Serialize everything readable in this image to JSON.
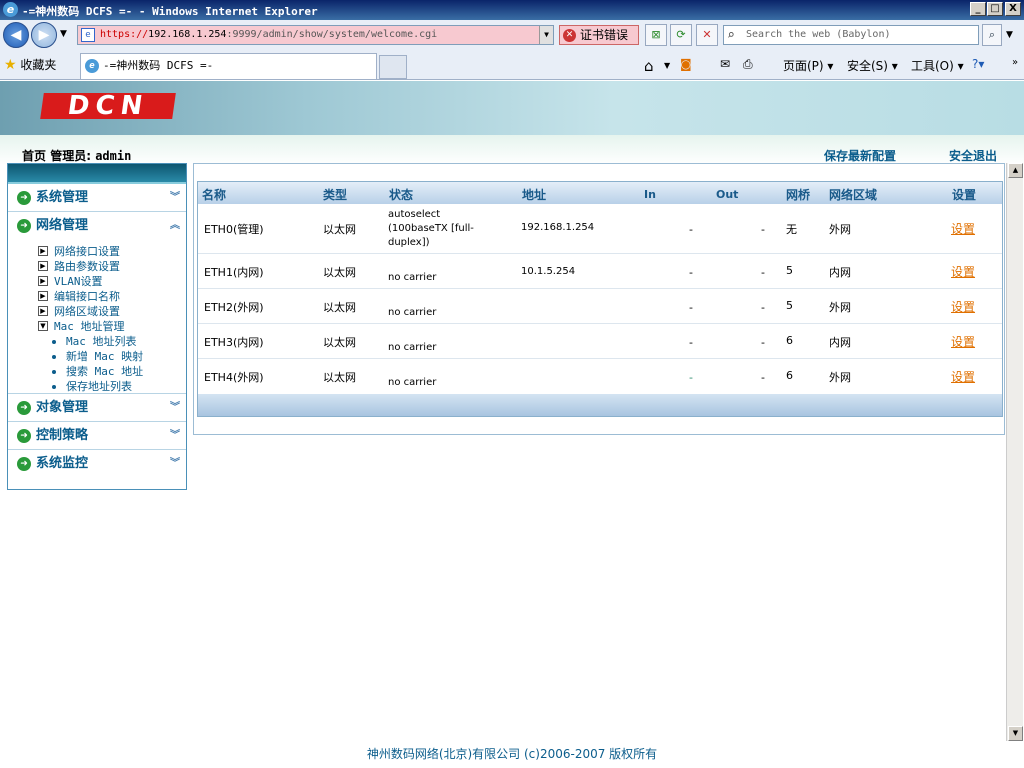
{
  "window": {
    "title": "-=神州数码 DCFS =- - Windows Internet Explorer",
    "minimize": "_",
    "maximize": "□",
    "close": "X"
  },
  "address": {
    "scheme": "https://",
    "host": "192.168.1.254",
    "rest": ":9999/admin/show/system/welcome.cgi",
    "cert_error": "证书错误",
    "search_placeholder": "Search the web (Babylon)"
  },
  "favbar": {
    "favorites": "收藏夹",
    "tab_title": "-=神州数码 DCFS =-",
    "page_menu": "页面(P)",
    "safety_menu": "安全(S)",
    "tools_menu": "工具(O)"
  },
  "header": {
    "logo": "DCN",
    "home": "首页",
    "admin_label": "管理员:",
    "admin_user": "admin",
    "save_config": "保存最新配置",
    "logout": "安全退出"
  },
  "sidebar": {
    "sections": [
      {
        "label": "系统管理"
      },
      {
        "label": "网络管理"
      },
      {
        "label": "对象管理"
      },
      {
        "label": "控制策略"
      },
      {
        "label": "系统监控"
      }
    ],
    "network_items": [
      "网络接口设置",
      "路由参数设置",
      "VLAN设置",
      "编辑接口名称",
      "网络区域设置",
      "Mac 地址管理"
    ],
    "mac_items": [
      "Mac 地址列表",
      "新增 Mac 映射",
      "搜索 Mac 地址",
      "保存地址列表"
    ]
  },
  "table": {
    "headers": {
      "name": "名称",
      "type": "类型",
      "status": "状态",
      "address": "地址",
      "in": "In",
      "out": "Out",
      "bridge": "网桥",
      "zone": "网络区域",
      "settings": "设置"
    },
    "rows": [
      {
        "name": "ETH0(管理)",
        "type": "以太网",
        "status": "autoselect (100baseTX [full-duplex])",
        "address": "192.168.1.254",
        "in": "-",
        "out": "-",
        "bridge": "无",
        "zone": "外网",
        "link": "设置"
      },
      {
        "name": "ETH1(内网)",
        "type": "以太网",
        "status": "no carrier",
        "address": "10.1.5.254",
        "in": "-",
        "out": "-",
        "bridge": "5",
        "zone": "内网",
        "link": "设置"
      },
      {
        "name": "ETH2(外网)",
        "type": "以太网",
        "status": "no carrier",
        "address": "",
        "in": "-",
        "out": "-",
        "bridge": "5",
        "zone": "外网",
        "link": "设置"
      },
      {
        "name": "ETH3(内网)",
        "type": "以太网",
        "status": "no carrier",
        "address": "",
        "in": "-",
        "out": "-",
        "bridge": "6",
        "zone": "内网",
        "link": "设置"
      },
      {
        "name": "ETH4(外网)",
        "type": "以太网",
        "status": "no carrier",
        "address": "",
        "in": "-",
        "out": "-",
        "bridge": "6",
        "zone": "外网",
        "link": "设置"
      }
    ]
  },
  "footer": "神州数码网络(北京)有限公司 (c)2006-2007 版权所有",
  "colors": {
    "accent": "#0b5d8c",
    "link": "#e07000",
    "cert_bg": "#f7c9d0"
  }
}
